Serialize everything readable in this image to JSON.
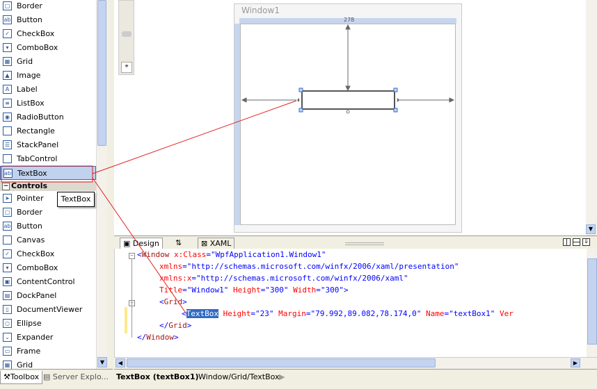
{
  "toolbox": {
    "items_top": [
      {
        "label": "Border",
        "icon": "border-icon",
        "glyph": "▢"
      },
      {
        "label": "Button",
        "icon": "button-icon",
        "glyph": "ab"
      },
      {
        "label": "CheckBox",
        "icon": "checkbox-icon",
        "glyph": "✓"
      },
      {
        "label": "ComboBox",
        "icon": "combobox-icon",
        "glyph": "▾"
      },
      {
        "label": "Grid",
        "icon": "grid-icon",
        "glyph": "▦"
      },
      {
        "label": "Image",
        "icon": "image-icon",
        "glyph": "▲"
      },
      {
        "label": "Label",
        "icon": "label-icon",
        "glyph": "A"
      },
      {
        "label": "ListBox",
        "icon": "listbox-icon",
        "glyph": "≡"
      },
      {
        "label": "RadioButton",
        "icon": "radiobutton-icon",
        "glyph": "◉"
      },
      {
        "label": "Rectangle",
        "icon": "rectangle-icon",
        "glyph": ""
      },
      {
        "label": "StackPanel",
        "icon": "stackpanel-icon",
        "glyph": "☰"
      },
      {
        "label": "TabControl",
        "icon": "tabcontrol-icon",
        "glyph": ""
      },
      {
        "label": "TextBox",
        "icon": "textbox-icon",
        "glyph": "abl"
      }
    ],
    "category": "Controls",
    "items_controls": [
      {
        "label": "Pointer",
        "icon": "pointer-icon",
        "glyph": "➤"
      },
      {
        "label": "Border",
        "icon": "border-icon",
        "glyph": "▢"
      },
      {
        "label": "Button",
        "icon": "button-icon",
        "glyph": "ab"
      },
      {
        "label": "Canvas",
        "icon": "canvas-icon",
        "glyph": ""
      },
      {
        "label": "CheckBox",
        "icon": "checkbox-icon",
        "glyph": "✓"
      },
      {
        "label": "ComboBox",
        "icon": "combobox-icon",
        "glyph": "▾"
      },
      {
        "label": "ContentControl",
        "icon": "contentcontrol-icon",
        "glyph": "▣"
      },
      {
        "label": "DockPanel",
        "icon": "dockpanel-icon",
        "glyph": "▤"
      },
      {
        "label": "DocumentViewer",
        "icon": "documentviewer-icon",
        "glyph": "▯"
      },
      {
        "label": "Ellipse",
        "icon": "ellipse-icon",
        "glyph": "○"
      },
      {
        "label": "Expander",
        "icon": "expander-icon",
        "glyph": "⌄"
      },
      {
        "label": "Frame",
        "icon": "frame-icon",
        "glyph": "▭"
      },
      {
        "label": "Grid",
        "icon": "grid-icon",
        "glyph": "▦"
      }
    ],
    "tooltip": "TextBox",
    "tabs": {
      "toolbox": "Toolbox",
      "server": "Server Explo..."
    }
  },
  "designer": {
    "window_title": "Window1",
    "width_label": "278"
  },
  "view_tabs": {
    "design": "Design",
    "swap": "⇅",
    "xaml": "XAML"
  },
  "xaml": {
    "l1": {
      "a": "<",
      "b": "Window ",
      "c": "x:Class",
      "d": "=\"",
      "e": "WpfApplication1.Window1",
      "f": "\""
    },
    "l2": {
      "a": "xmlns",
      "b": "=\"",
      "c": "http://schemas.microsoft.com/winfx/2006/xaml/presentation",
      "d": "\""
    },
    "l3": {
      "a": "xmlns:x",
      "b": "=\"",
      "c": "http://schemas.microsoft.com/winfx/2006/xaml",
      "d": "\""
    },
    "l4": {
      "a": "Title",
      "b": "=\"",
      "c": "Window1",
      "d": "\" ",
      "e": "Height",
      "f": "=\"",
      "g": "300",
      "h": "\" ",
      "i": "Width",
      "j": "=\"",
      "k": "300",
      "l": "\">"
    },
    "l5": {
      "a": "<",
      "b": "Grid",
      "c": ">"
    },
    "l6": {
      "a": "<",
      "b": "TextBox",
      "c": " Height",
      "d": "=\"",
      "e": "23",
      "f": "\" ",
      "g": "Margin",
      "h": "=\"",
      "i": "79.992,89.082,78.174,0",
      "j": "\" ",
      "k": "Name",
      "l": "=\"",
      "m": "textBox1",
      "n": "\" ",
      "o": "Ver"
    },
    "l7": {
      "a": "</",
      "b": "Grid",
      "c": ">"
    },
    "l8": {
      "a": "</",
      "b": "Window",
      "c": ">"
    }
  },
  "status": {
    "selection": "TextBox (textBox1)",
    "path": "Window/Grid/TextBox",
    "arrow": "▶"
  },
  "colors": {
    "annotation": "#e02020",
    "selection": "#316ac5",
    "rail": "#c7d6ee"
  }
}
